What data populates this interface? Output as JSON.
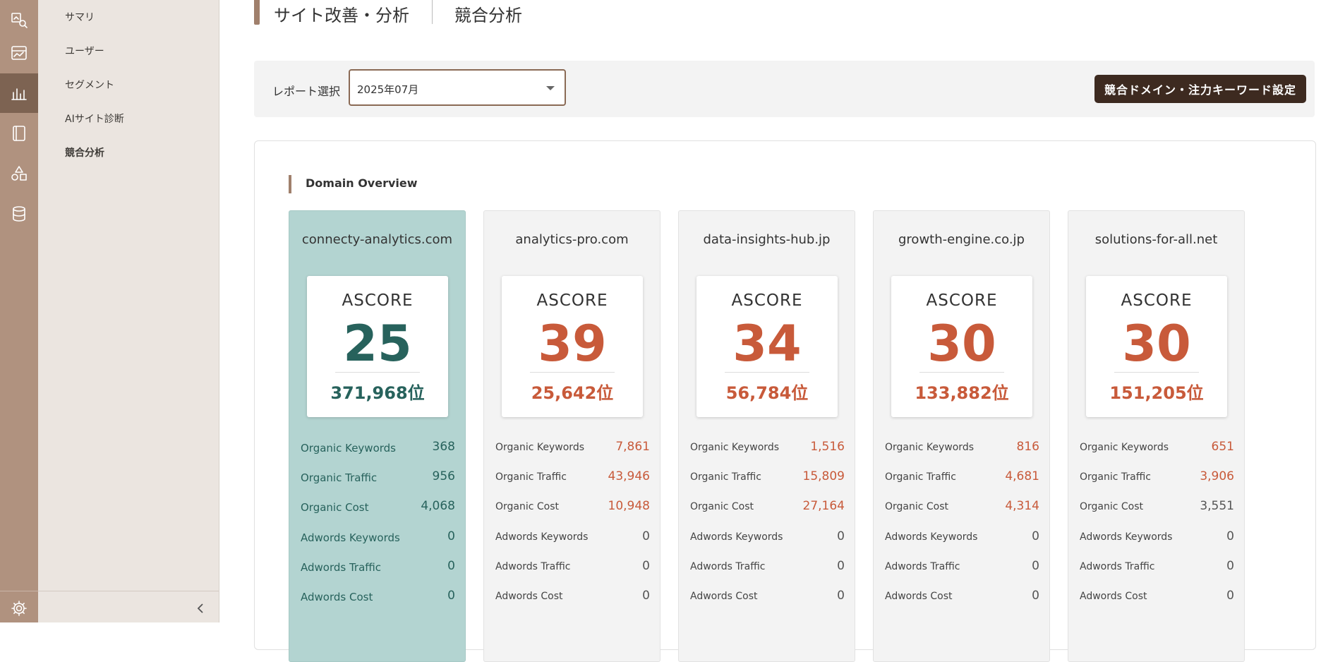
{
  "nav": {
    "icons": [
      "analytics-icon",
      "chart-window-icon",
      "bar-chart-icon",
      "document-icon",
      "shapes-icon",
      "database-icon"
    ],
    "settings_icon": "gear-icon"
  },
  "subnav": {
    "items": [
      {
        "label": "サマリ"
      },
      {
        "label": "ユーザー"
      },
      {
        "label": "セグメント"
      },
      {
        "label": "AIサイト診断"
      },
      {
        "label": "競合分析"
      }
    ]
  },
  "header": {
    "title": "サイト改善・分析",
    "subtitle": "競合分析"
  },
  "report": {
    "label": "レポート選択",
    "selected": "2025年07月",
    "settings_button": "競合ドメイン・注力キーワード設定"
  },
  "overview": {
    "title": "Domain Overview",
    "score_label": "ASCORE",
    "metric_labels": [
      "Organic Keywords",
      "Organic Traffic",
      "Organic Cost",
      "Adwords Keywords",
      "Adwords Traffic",
      "Adwords Cost"
    ],
    "domains": [
      {
        "name": "connecty-analytics.com",
        "score": "25",
        "rank": "371,968位",
        "metrics": [
          "368",
          "956",
          "4,068",
          "0",
          "0",
          "0"
        ]
      },
      {
        "name": "analytics-pro.com",
        "score": "39",
        "rank": "25,642位",
        "metrics": [
          "7,861",
          "43,946",
          "10,948",
          "0",
          "0",
          "0"
        ]
      },
      {
        "name": "data-insights-hub.jp",
        "score": "34",
        "rank": "56,784位",
        "metrics": [
          "1,516",
          "15,809",
          "27,164",
          "0",
          "0",
          "0"
        ]
      },
      {
        "name": "growth-engine.co.jp",
        "score": "30",
        "rank": "133,882位",
        "metrics": [
          "816",
          "4,681",
          "4,314",
          "0",
          "0",
          "0"
        ]
      },
      {
        "name": "solutions-for-all.net",
        "score": "30",
        "rank": "151,205位",
        "metrics": [
          "651",
          "3,906",
          "3,551",
          "0",
          "0",
          "0"
        ]
      }
    ]
  },
  "colors": {
    "rail": "#b0927f",
    "rail_active": "#7d6352",
    "self_card": "#b3d4d1",
    "self_text": "#27625c",
    "highlight": "#c85a3a",
    "button": "#3d2a20"
  }
}
